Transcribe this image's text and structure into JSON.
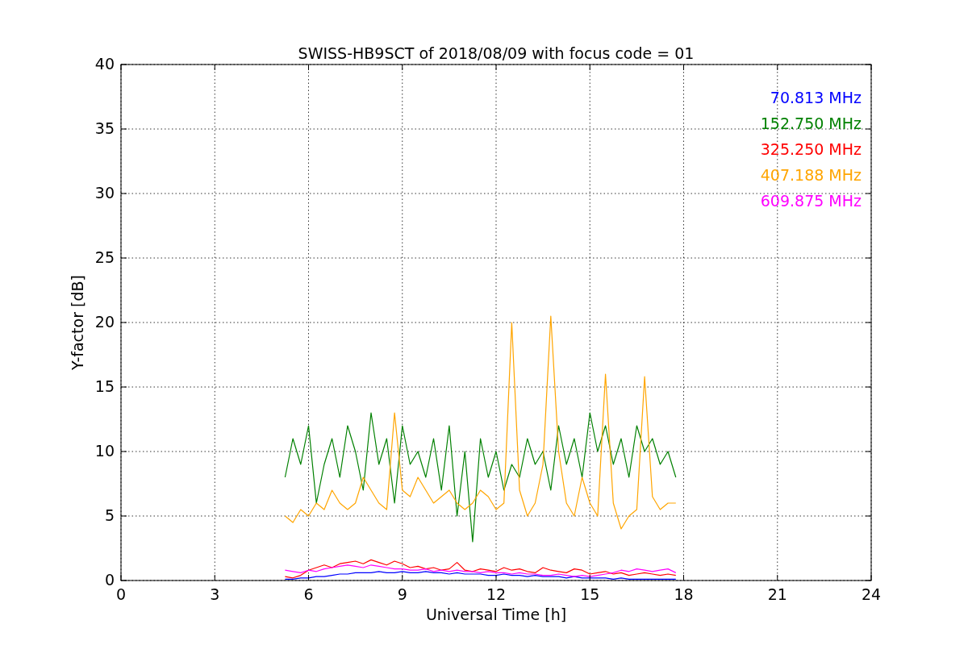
{
  "chart_data": {
    "type": "line",
    "title": "SWISS-HB9SCT of 2018/08/09 with focus code = 01",
    "xlabel": "Universal Time [h]",
    "ylabel": "Y-factor [dB]",
    "x": [
      5.25,
      5.5,
      5.75,
      6,
      6.25,
      6.5,
      6.75,
      7,
      7.25,
      7.5,
      7.75,
      8,
      8.25,
      8.5,
      8.75,
      9,
      9.25,
      9.5,
      9.75,
      10,
      10.25,
      10.5,
      10.75,
      11,
      11.25,
      11.5,
      11.75,
      12,
      12.25,
      12.5,
      12.75,
      13,
      13.25,
      13.5,
      13.75,
      14,
      14.25,
      14.5,
      14.75,
      15,
      15.25,
      15.5,
      15.75,
      16,
      16.25,
      16.5,
      16.75,
      17,
      17.25,
      17.5,
      17.75
    ],
    "series": [
      {
        "name": "70.813 MHz",
        "color": "#0000ff",
        "values": [
          0.1,
          0.1,
          0.2,
          0.2,
          0.3,
          0.3,
          0.4,
          0.5,
          0.5,
          0.6,
          0.6,
          0.6,
          0.7,
          0.6,
          0.6,
          0.7,
          0.6,
          0.6,
          0.7,
          0.6,
          0.6,
          0.5,
          0.6,
          0.5,
          0.5,
          0.5,
          0.4,
          0.4,
          0.5,
          0.4,
          0.4,
          0.3,
          0.4,
          0.3,
          0.3,
          0.3,
          0.2,
          0.3,
          0.2,
          0.2,
          0.2,
          0.2,
          0.1,
          0.2,
          0.1,
          0.1,
          0.1,
          0.1,
          0.1,
          0.1,
          0.1
        ]
      },
      {
        "name": "152.750 MHz",
        "color": "#008000",
        "values": [
          8,
          11,
          9,
          12,
          6,
          9,
          11,
          8,
          12,
          10,
          7,
          13,
          9,
          11,
          6,
          12,
          9,
          10,
          8,
          11,
          7,
          12,
          5,
          10,
          3,
          11,
          8,
          10,
          7,
          9,
          8,
          11,
          9,
          10,
          7,
          12,
          9,
          11,
          8,
          13,
          10,
          12,
          9,
          11,
          8,
          12,
          10,
          11,
          9,
          10,
          8
        ]
      },
      {
        "name": "325.250 MHz",
        "color": "#ff0000",
        "values": [
          0.3,
          0.2,
          0.4,
          0.8,
          1,
          1.2,
          1,
          1.3,
          1.4,
          1.5,
          1.3,
          1.6,
          1.4,
          1.2,
          1.5,
          1.3,
          1,
          1.1,
          0.9,
          1,
          0.8,
          0.9,
          1.4,
          0.8,
          0.7,
          0.9,
          0.8,
          0.7,
          1,
          0.8,
          0.9,
          0.7,
          0.6,
          1,
          0.8,
          0.7,
          0.6,
          0.9,
          0.8,
          0.5,
          0.6,
          0.7,
          0.5,
          0.6,
          0.4,
          0.5,
          0.6,
          0.5,
          0.4,
          0.5,
          0.4
        ]
      },
      {
        "name": "407.188 MHz",
        "color": "#ffa500",
        "values": [
          5,
          4.5,
          5.5,
          5,
          6,
          5.5,
          7,
          6,
          5.5,
          6,
          8,
          7,
          6,
          5.5,
          13,
          7,
          6.5,
          8,
          7,
          6,
          6.5,
          7,
          6,
          5.5,
          6,
          7,
          6.5,
          5.5,
          6,
          20,
          7,
          5,
          6,
          9,
          20.5,
          10,
          6,
          5,
          8,
          6,
          5,
          16,
          6,
          4,
          5,
          5.5,
          15.8,
          6.5,
          5.5,
          6,
          6
        ]
      },
      {
        "name": "609.875 MHz",
        "color": "#ff00ff",
        "values": [
          0.8,
          0.7,
          0.6,
          0.8,
          0.7,
          0.9,
          1,
          1.1,
          1.2,
          1.1,
          1,
          1.2,
          1.1,
          1,
          0.9,
          0.9,
          0.8,
          0.8,
          0.9,
          0.7,
          0.8,
          0.7,
          0.8,
          0.7,
          0.7,
          0.6,
          0.7,
          0.6,
          0.6,
          0.5,
          0.6,
          0.5,
          0.5,
          0.4,
          0.4,
          0.5,
          0.4,
          0.3,
          0.4,
          0.3,
          0.4,
          0.5,
          0.6,
          0.8,
          0.7,
          0.9,
          0.8,
          0.7,
          0.8,
          0.9,
          0.6
        ]
      }
    ],
    "grid": true,
    "xlim": [
      0,
      24
    ],
    "ylim": [
      0,
      40
    ],
    "xticks": [
      0,
      3,
      6,
      9,
      12,
      15,
      18,
      21,
      24
    ],
    "yticks": [
      0,
      5,
      10,
      15,
      20,
      25,
      30,
      35,
      40
    ]
  }
}
